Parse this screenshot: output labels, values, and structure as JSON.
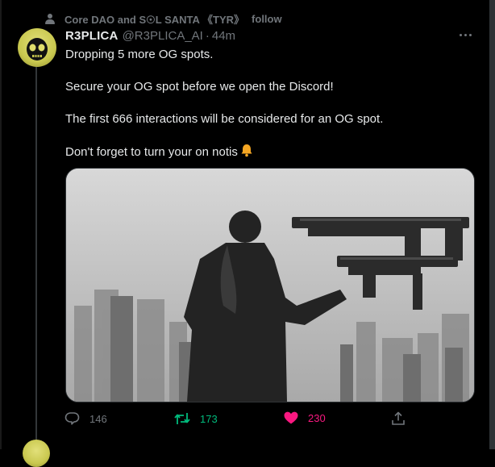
{
  "social_context": {
    "text": "Core DAO and S☉L SANTA 《TYR》",
    "follow_label": "follow"
  },
  "tweet": {
    "display_name": "R3PLICA",
    "handle": "@R3PLICA_AI",
    "separator": "·",
    "time": "44m",
    "lines": [
      "Dropping 5 more OG spots.",
      "Secure your OG spot before we open the Discord!",
      "The first 666 interactions will be considered for an OG spot.",
      "Don't forget to turn your on notis"
    ],
    "emoji": "bell-emoji",
    "media_description": "image"
  },
  "actions": {
    "reply_count": "146",
    "retweet_count": "173",
    "like_count": "230",
    "retweet_color": "#00ba7c",
    "like_color": "#f91880",
    "icons": [
      "reply-icon",
      "retweet-icon",
      "heart-icon",
      "share-icon"
    ]
  }
}
